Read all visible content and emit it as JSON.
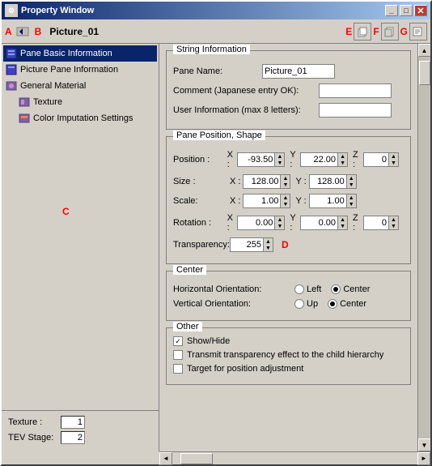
{
  "window": {
    "title": "Property Window",
    "close_btn": "✕"
  },
  "toolbar": {
    "icon": "🔧",
    "name": "Picture_01",
    "btn_e_label": "E",
    "btn_f_label": "F",
    "btn_g_label": "G",
    "marker_a": "A",
    "marker_b": "B"
  },
  "sidebar": {
    "items": [
      {
        "id": "pane-basic",
        "label": "Pane Basic Information",
        "selected": true,
        "indent": 0
      },
      {
        "id": "picture-pane",
        "label": "Picture Pane Information",
        "selected": false,
        "indent": 0
      },
      {
        "id": "general-material",
        "label": "General Material",
        "selected": false,
        "indent": 0
      },
      {
        "id": "texture",
        "label": "Texture",
        "selected": false,
        "indent": 1
      },
      {
        "id": "color-imputation",
        "label": "Color Imputation Settings",
        "selected": false,
        "indent": 1
      }
    ],
    "marker_c": "C",
    "bottom": {
      "texture_label": "Texture :",
      "texture_value": "1",
      "tev_label": "TEV Stage:",
      "tev_value": "2"
    }
  },
  "main": {
    "string_info": {
      "title": "String Information",
      "pane_name_label": "Pane Name:",
      "pane_name_value": "Picture_01",
      "comment_label": "Comment (Japanese entry OK):",
      "user_info_label": "User Information (max 8 letters):"
    },
    "pane_position": {
      "title": "Pane Position, Shape",
      "position_label": "Position :",
      "pos_x_label": "X :",
      "pos_x_value": "-93.50",
      "pos_y_label": "Y :",
      "pos_y_value": "22.00",
      "pos_z_label": "Z :",
      "pos_z_value": "0",
      "size_label": "Size :",
      "size_x_label": "X :",
      "size_x_value": "128.00",
      "size_y_label": "Y :",
      "size_y_value": "128.00",
      "scale_label": "Scale:",
      "scale_x_label": "X :",
      "scale_x_value": "1.00",
      "scale_y_label": "Y :",
      "scale_y_value": "1.00",
      "rotation_label": "Rotation :",
      "rot_x_label": "X :",
      "rot_x_value": "0.00",
      "rot_y_label": "Y :",
      "rot_y_value": "0.00",
      "rot_z_label": "Z :",
      "rot_z_value": "0",
      "transparency_label": "Transparency:",
      "transparency_value": "255",
      "marker_d": "D"
    },
    "center": {
      "title": "Center",
      "h_orient_label": "Horizontal Orientation:",
      "h_left_label": "Left",
      "h_center_label": "Center",
      "h_left_checked": false,
      "h_center_checked": true,
      "v_orient_label": "Vertical Orientation:",
      "v_up_label": "Up",
      "v_center_label": "Center",
      "v_up_checked": false,
      "v_center_checked": true
    },
    "other": {
      "title": "Other",
      "show_hide_label": "Show/Hide",
      "show_hide_checked": true,
      "transmit_label": "Transmit transparency effect to the child hierarchy",
      "transmit_checked": false,
      "target_label": "Target for position adjustment",
      "target_checked": false
    }
  }
}
